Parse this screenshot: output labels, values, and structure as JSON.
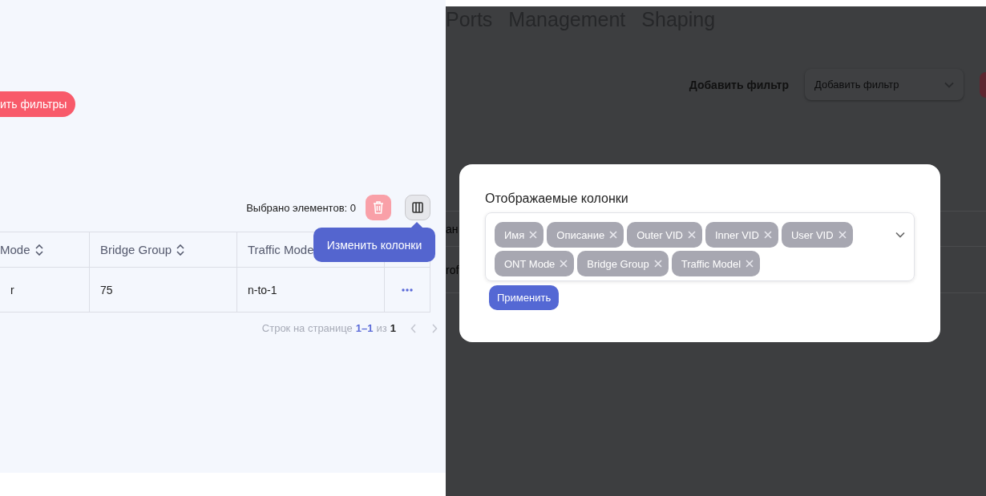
{
  "filters_panel": {
    "reset_button": "ить фильтры"
  },
  "toolbar": {
    "selected_count": "Выбрано элементов: 0"
  },
  "tooltip": "Изменить колонки",
  "table": {
    "columns": [
      {
        "label": "Mode",
        "sortable": true
      },
      {
        "label": "Bridge Group",
        "sortable": true
      },
      {
        "label": "Traffic Mode"
      }
    ],
    "rows": [
      {
        "cells": [
          "r",
          "75",
          "n-to-1"
        ]
      }
    ]
  },
  "pagination": {
    "label": "Строк на странице",
    "range": "1–1",
    "of": "из",
    "total": "1"
  },
  "background_page": {
    "tabs": [
      "Ports",
      "Management",
      "Shaping"
    ],
    "filter_label": "Добавить фильтр",
    "filter_select": {
      "placeholder": "Добавить фильтр"
    },
    "table_fragments": [
      "ан",
      "rof"
    ]
  },
  "modal": {
    "title": "Отображаемые колонки",
    "chips": [
      "Имя",
      "Описание",
      "Outer VID",
      "Inner VID",
      "User VID",
      "ONT Mode",
      "Bridge Group",
      "Traffic Model"
    ],
    "apply_button": "Применить"
  }
}
